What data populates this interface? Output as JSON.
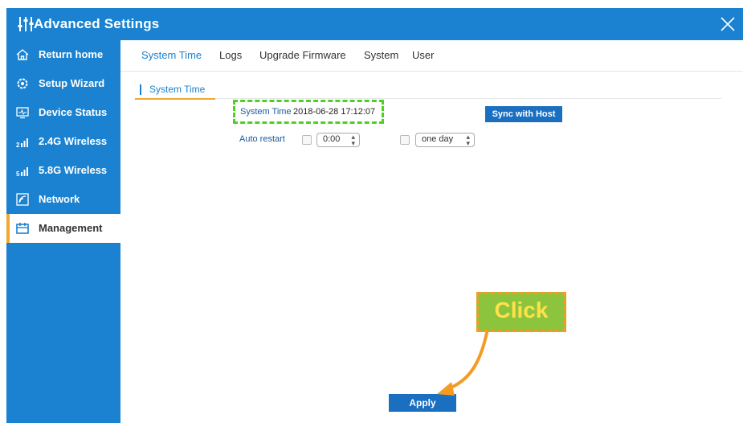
{
  "window": {
    "title": "Advanced Settings",
    "icons": {
      "title": "sliders-icon",
      "close": "close-icon"
    }
  },
  "sidebar": {
    "items": [
      {
        "label": "Return home",
        "icon": "home-icon",
        "active": false
      },
      {
        "label": "Setup Wizard",
        "icon": "gear-icon",
        "active": false
      },
      {
        "label": "Device Status",
        "icon": "monitor-icon",
        "active": false
      },
      {
        "label": "2.4G Wireless",
        "icon": "signal-2g-icon",
        "active": false
      },
      {
        "label": "5.8G Wireless",
        "icon": "signal-5g-icon",
        "active": false
      },
      {
        "label": "Network",
        "icon": "network-icon",
        "active": false
      },
      {
        "label": "Management",
        "icon": "management-icon",
        "active": true
      }
    ]
  },
  "tabs": [
    {
      "label": "System Time",
      "active": true
    },
    {
      "label": "Logs",
      "active": false
    },
    {
      "label": "Upgrade Firmware",
      "active": false
    },
    {
      "label": "System",
      "active": false
    },
    {
      "label": "User",
      "active": false
    }
  ],
  "subsection": {
    "label": "System Time"
  },
  "system_time": {
    "label": "System Time",
    "value": "2018-06-28 17:12:07",
    "sync_button": "Sync with Host"
  },
  "auto_restart": {
    "label": "Auto restart",
    "time_checked": false,
    "time_value": "0:00",
    "interval_checked": false,
    "interval_value": "one day"
  },
  "apply_button": "Apply",
  "annotation": {
    "text": "Click",
    "colors": {
      "box": "#8cc43d",
      "border": "#f59a23",
      "text": "#ffe14a",
      "arrow": "#f59a23",
      "highlight": "#4bd21f"
    }
  },
  "colors": {
    "accent": "#1a82d0",
    "button": "#1a6fc0",
    "active_marker": "#f0a830"
  }
}
